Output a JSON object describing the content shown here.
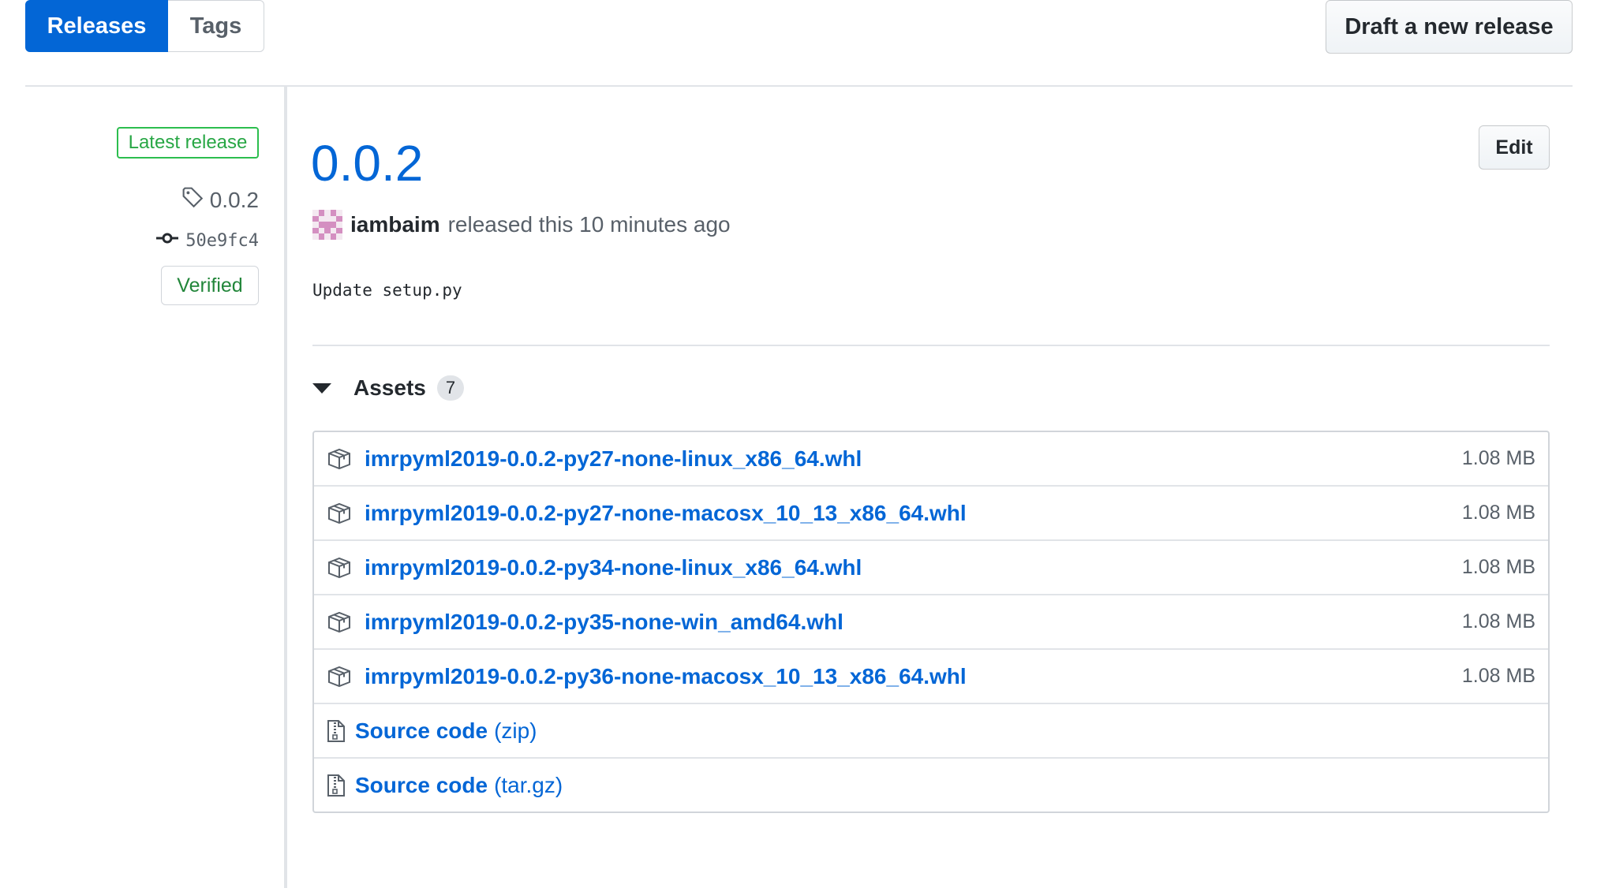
{
  "tabs": {
    "releases": "Releases",
    "tags": "Tags"
  },
  "actions": {
    "draft": "Draft a new release",
    "edit": "Edit"
  },
  "sidebar": {
    "badge": "Latest release",
    "tag": "0.0.2",
    "commit": "50e9fc4",
    "verified": "Verified"
  },
  "release": {
    "title": "0.0.2",
    "author": "iambaim",
    "released_text": "released this 10 minutes ago",
    "notes": "Update setup.py"
  },
  "assets": {
    "label": "Assets",
    "count": "7",
    "files": [
      {
        "name": "imrpyml2019-0.0.2-py27-none-linux_x86_64.whl",
        "size": "1.08 MB"
      },
      {
        "name": "imrpyml2019-0.0.2-py27-none-macosx_10_13_x86_64.whl",
        "size": "1.08 MB"
      },
      {
        "name": "imrpyml2019-0.0.2-py34-none-linux_x86_64.whl",
        "size": "1.08 MB"
      },
      {
        "name": "imrpyml2019-0.0.2-py35-none-win_amd64.whl",
        "size": "1.08 MB"
      },
      {
        "name": "imrpyml2019-0.0.2-py36-none-macosx_10_13_x86_64.whl",
        "size": "1.08 MB"
      }
    ],
    "source": [
      {
        "name": "Source code",
        "format": "(zip)"
      },
      {
        "name": "Source code",
        "format": "(tar.gz)"
      }
    ]
  },
  "colors": {
    "accent": "#0366d6",
    "success": "#28a745",
    "muted": "#586069"
  },
  "icons": [
    "tag-icon",
    "commit-icon",
    "package-icon",
    "file-zip-icon",
    "triangle-down-icon"
  ]
}
